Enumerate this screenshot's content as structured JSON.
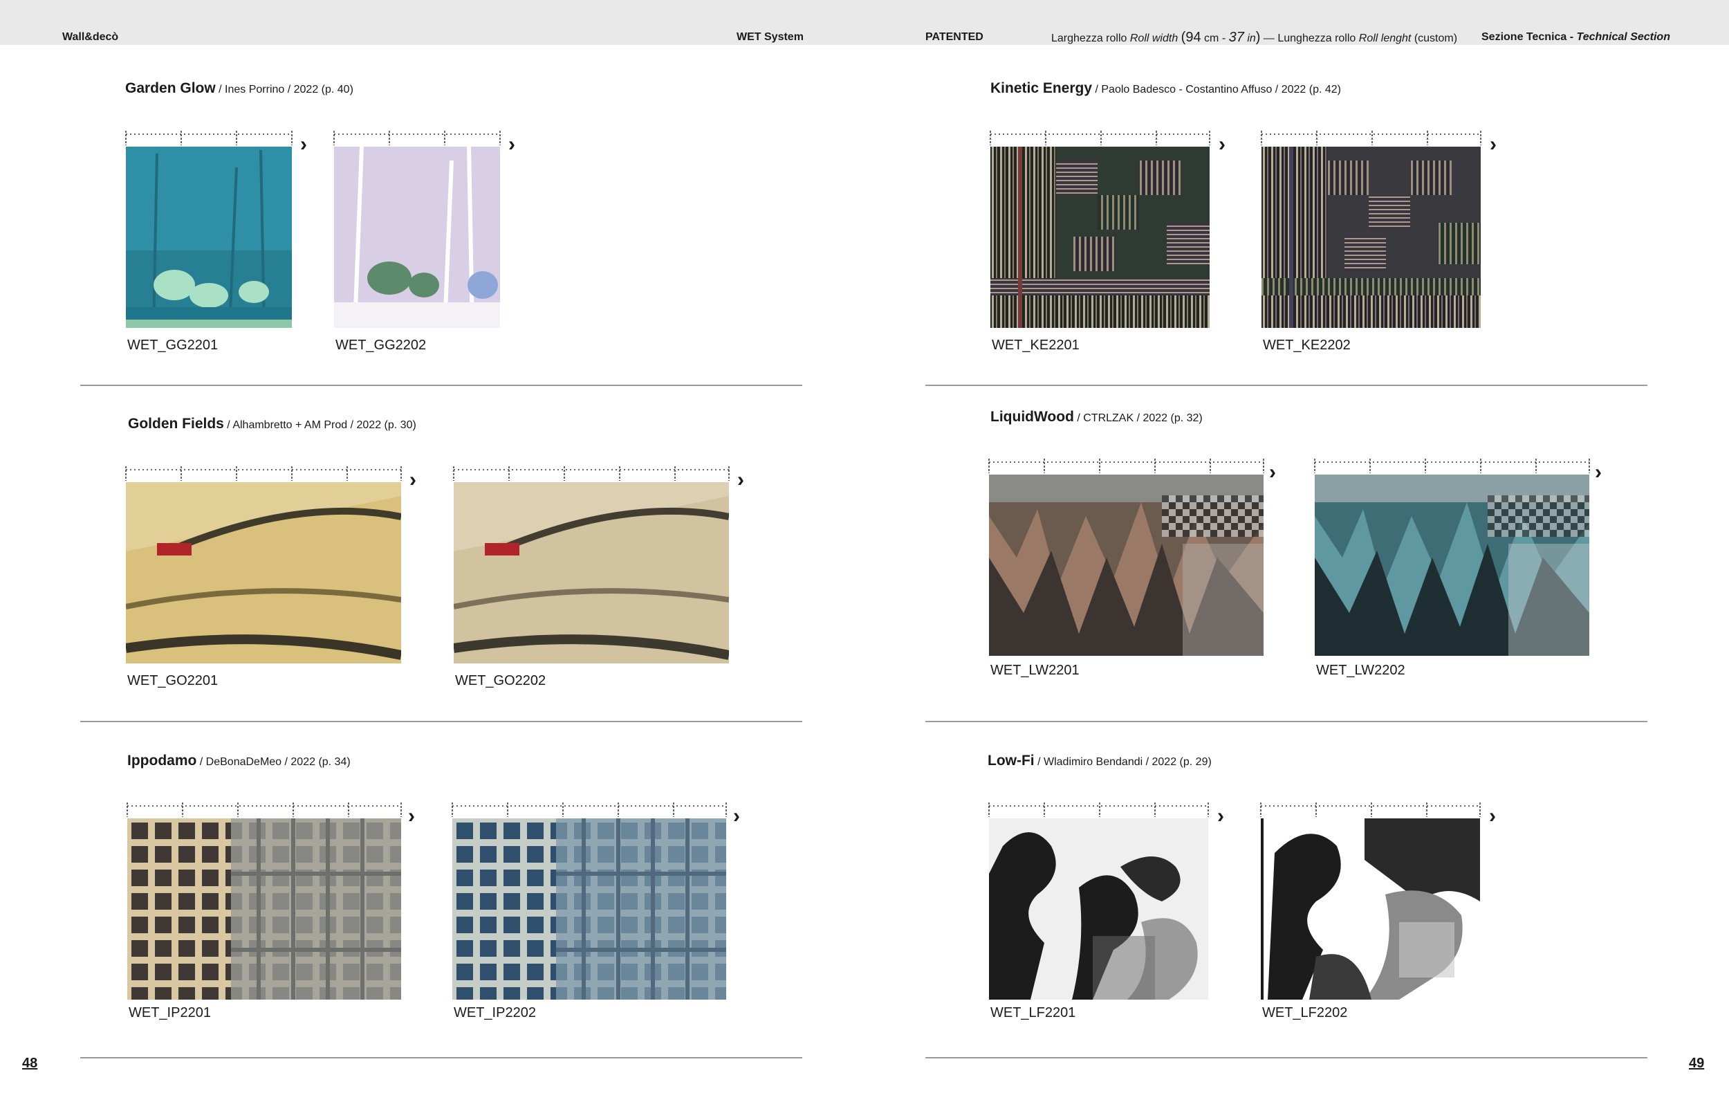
{
  "header": {
    "brand": "Wall&decò",
    "system": "WET System",
    "patented": "PATENTED",
    "roll_width_it": "Larghezza rollo",
    "roll_width_en": "Roll width",
    "roll_width_open": "(",
    "roll_width_cm_num": "94",
    "roll_width_cm_unit": "cm -",
    "roll_width_in_num": "37",
    "roll_width_in_unit": "in",
    "roll_width_close": ")",
    "dash": "—",
    "roll_length_it": "Lunghezza rollo",
    "roll_length_en": "Roll lenght",
    "roll_length_note": "(custom)",
    "section_it": "Sezione Tecnica -",
    "section_en": "Technical Section"
  },
  "pages": {
    "left": "48",
    "right": "49"
  },
  "sections": [
    {
      "name": "Garden Glow",
      "meta": " / Ines Porrino / 2022 (p. 40)",
      "codes": [
        "WET_GG2201",
        "WET_GG2202"
      ]
    },
    {
      "name": "Golden Fields",
      "meta": " / Alhambretto + AM Prod / 2022 (p. 30)",
      "codes": [
        "WET_GO2201",
        "WET_GO2202"
      ]
    },
    {
      "name": "Ippodamo",
      "meta": " / DeBonaDeMeo / 2022 (p. 34)",
      "codes": [
        "WET_IP2201",
        "WET_IP2202"
      ]
    },
    {
      "name": "Kinetic Energy",
      "meta": " / Paolo Badesco - Costantino Affuso / 2022 (p. 42)",
      "codes": [
        "WET_KE2201",
        "WET_KE2202"
      ]
    },
    {
      "name": "LiquidWood",
      "meta": " / CTRLZAK / 2022 (p. 32)",
      "codes": [
        "WET_LW2201",
        "WET_LW2202"
      ]
    },
    {
      "name": "Low-Fi",
      "meta": " / Wladimiro Bendandi / 2022 (p. 29)",
      "codes": [
        "WET_LF2201",
        "WET_LF2202"
      ]
    }
  ],
  "icons": {
    "next": "chevron-right-icon",
    "ruler": "roll-ruler-icon"
  },
  "colors": {
    "garden_glow_1": "#2f8fa6",
    "garden_glow_2": "#d8cfe6",
    "golden_fields_1": "#d9c07c",
    "golden_fields_2": "#d2c3a0",
    "ippodamo_1": "#8a8278",
    "ippodamo_2": "#5c7a92",
    "kinetic_1": "#2f3a33",
    "kinetic_2": "#3a3a3e",
    "liquidwood_1": "#6b5a4e",
    "liquidwood_2": "#3f6d76",
    "lowfi": "#1c1c1c"
  }
}
